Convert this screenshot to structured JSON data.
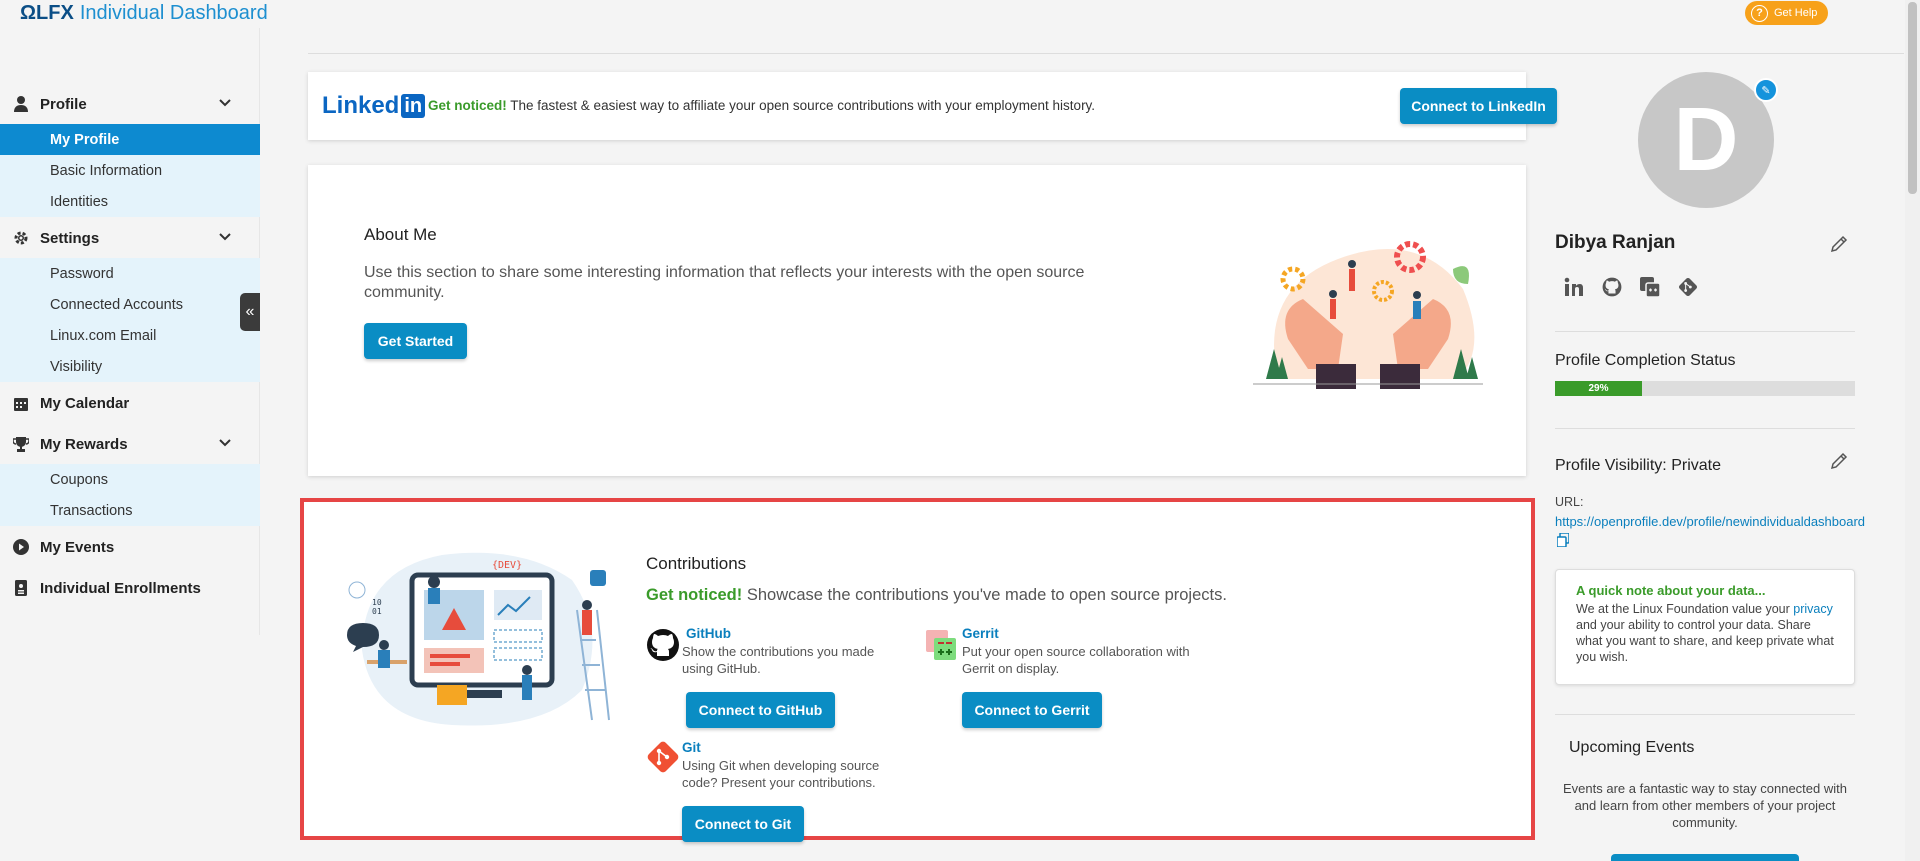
{
  "header": {
    "logo_mark": "ΩLFX",
    "app_title": "Individual Dashboard",
    "help_label": "Get Help"
  },
  "sidebar": {
    "sections": [
      {
        "label": "Profile",
        "icon": "user-icon",
        "items": [
          "My Profile",
          "Basic Information",
          "Identities"
        ],
        "active": "My Profile"
      },
      {
        "label": "Settings",
        "icon": "gear-icon",
        "items": [
          "Password",
          "Connected Accounts",
          "Linux.com Email",
          "Visibility"
        ]
      },
      {
        "label": "My Calendar",
        "icon": "calendar-icon"
      },
      {
        "label": "My Rewards",
        "icon": "trophy-icon",
        "items": [
          "Coupons",
          "Transactions"
        ]
      },
      {
        "label": "My Events",
        "icon": "play-circle-icon"
      },
      {
        "label": "Individual Enrollments",
        "icon": "badge-icon"
      }
    ],
    "collapse_glyph": "«"
  },
  "linkedin": {
    "logo_text": "Linked",
    "logo_in": "in",
    "highlight": "Get noticed!",
    "text": " The fastest & easiest way to affiliate your open source contributions with your employment history.",
    "button": "Connect to LinkedIn"
  },
  "about": {
    "title": "About Me",
    "description": "Use this section to share some interesting information that reflects your interests with the open source community.",
    "button": "Get Started"
  },
  "contributions": {
    "title": "Contributions",
    "highlight": "Get noticed!",
    "description": " Showcase the contributions you've made to open source projects.",
    "providers": [
      {
        "name": "GitHub",
        "description": "Show the contributions you made using GitHub.",
        "button": "Connect to GitHub",
        "icon": "github-icon"
      },
      {
        "name": "Gerrit",
        "description": "Put your open source collaboration with Gerrit on display.",
        "button": "Connect to Gerrit",
        "icon": "gerrit-icon"
      },
      {
        "name": "Git",
        "description": "Using Git when developing source code? Present your contributions.",
        "button": "Connect to Git",
        "icon": "git-icon"
      }
    ]
  },
  "profile": {
    "avatar_initial": "D",
    "name": "Dibya Ranjan",
    "social_icons": [
      "linkedin-icon",
      "github-icon",
      "gerrit-icon",
      "git-icon"
    ],
    "completion_title": "Profile Completion Status",
    "completion_percent": 29,
    "completion_label": "29%",
    "visibility_title": "Profile Visibility: Private",
    "url_label": "URL:",
    "url": "https://openprofile.dev/profile/newindividualdashboard"
  },
  "note": {
    "title": "A quick note about your data...",
    "text_before": "We at the Linux Foundation value your ",
    "link": "privacy",
    "text_after": " and your ability to control your data. Share what you want to share, and keep private what you wish."
  },
  "events": {
    "title": "Upcoming Events",
    "description": "Events are a fantastic way to stay connected with and learn from other members of your project community."
  },
  "colors": {
    "primary": "#0a8dc4",
    "active_nav": "#0d8ad0",
    "green": "#3a9b2a",
    "highlight_border": "#e64545",
    "help": "#f7a11a"
  }
}
